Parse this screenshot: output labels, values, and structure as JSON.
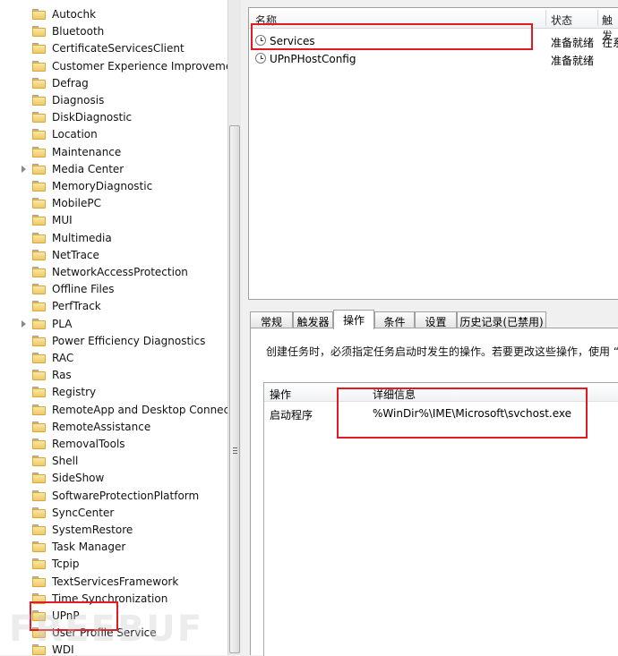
{
  "tree": {
    "items": [
      {
        "label": "Autochk",
        "expandable": false
      },
      {
        "label": "Bluetooth",
        "expandable": false
      },
      {
        "label": "CertificateServicesClient",
        "expandable": false
      },
      {
        "label": "Customer Experience Improvement",
        "expandable": false
      },
      {
        "label": "Defrag",
        "expandable": false
      },
      {
        "label": "Diagnosis",
        "expandable": false
      },
      {
        "label": "DiskDiagnostic",
        "expandable": false
      },
      {
        "label": "Location",
        "expandable": false
      },
      {
        "label": "Maintenance",
        "expandable": false
      },
      {
        "label": "Media Center",
        "expandable": true
      },
      {
        "label": "MemoryDiagnostic",
        "expandable": false
      },
      {
        "label": "MobilePC",
        "expandable": false
      },
      {
        "label": "MUI",
        "expandable": false
      },
      {
        "label": "Multimedia",
        "expandable": false
      },
      {
        "label": "NetTrace",
        "expandable": false
      },
      {
        "label": "NetworkAccessProtection",
        "expandable": false
      },
      {
        "label": "Offline Files",
        "expandable": false
      },
      {
        "label": "PerfTrack",
        "expandable": false
      },
      {
        "label": "PLA",
        "expandable": true
      },
      {
        "label": "Power Efficiency Diagnostics",
        "expandable": false
      },
      {
        "label": "RAC",
        "expandable": false
      },
      {
        "label": "Ras",
        "expandable": false
      },
      {
        "label": "Registry",
        "expandable": false
      },
      {
        "label": "RemoteApp and Desktop Connecti",
        "expandable": false
      },
      {
        "label": "RemoteAssistance",
        "expandable": false
      },
      {
        "label": "RemovalTools",
        "expandable": false
      },
      {
        "label": "Shell",
        "expandable": false
      },
      {
        "label": "SideShow",
        "expandable": false
      },
      {
        "label": "SoftwareProtectionPlatform",
        "expandable": false
      },
      {
        "label": "SyncCenter",
        "expandable": false
      },
      {
        "label": "SystemRestore",
        "expandable": false
      },
      {
        "label": "Task Manager",
        "expandable": false
      },
      {
        "label": "Tcpip",
        "expandable": false
      },
      {
        "label": "TextServicesFramework",
        "expandable": false
      },
      {
        "label": "Time Synchronization",
        "expandable": false
      },
      {
        "label": "UPnP",
        "expandable": false
      },
      {
        "label": "User Profile Service",
        "expandable": false
      },
      {
        "label": "WDI",
        "expandable": false
      }
    ]
  },
  "task_list": {
    "columns": [
      "名称",
      "状态",
      "触发"
    ],
    "rows": [
      {
        "name": "Services",
        "status": "准备就绪",
        "trigger": "在系"
      },
      {
        "name": "UPnPHostConfig",
        "status": "准备就绪",
        "trigger": ""
      }
    ]
  },
  "tabs": [
    {
      "label": "常规",
      "active": false
    },
    {
      "label": "触发器",
      "active": false
    },
    {
      "label": "操作",
      "active": true
    },
    {
      "label": "条件",
      "active": false
    },
    {
      "label": "设置",
      "active": false
    },
    {
      "label": "历史记录(已禁用)",
      "active": false
    }
  ],
  "actions_tab": {
    "description": "创建任务时，必须指定任务启动时发生的操作。若要更改这些操作，使用 “属性",
    "columns": [
      "操作",
      "详细信息"
    ],
    "rows": [
      {
        "action": "启动程序",
        "details": "%WinDir%\\IME\\Microsoft\\svchost.exe"
      }
    ]
  },
  "watermark": "FREEBUF"
}
